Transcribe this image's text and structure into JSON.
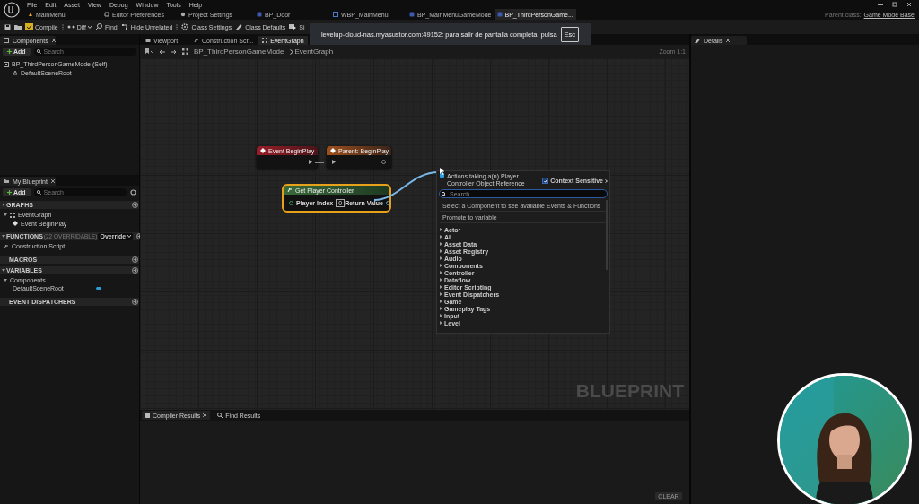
{
  "menu_bar": [
    "File",
    "Edit",
    "Asset",
    "View",
    "Debug",
    "Window",
    "Tools",
    "Help"
  ],
  "document_tabs": [
    {
      "label": "MainMenu",
      "selected": false
    },
    {
      "label": "Editor Preferences",
      "selected": false
    },
    {
      "label": "Project Settings",
      "selected": false
    },
    {
      "label": "BP_Door",
      "selected": false
    },
    {
      "label": "WBP_MainMenu",
      "selected": false
    },
    {
      "label": "BP_MainMenuGameMode",
      "selected": false
    },
    {
      "label": "BP_ThirdPersonGame...",
      "selected": true
    }
  ],
  "parent_class": {
    "label": "Parent class:",
    "value": "Game Mode Base"
  },
  "toolbar": [
    {
      "kind": "compile",
      "label": "Compile"
    },
    {
      "kind": "diff",
      "label": "Diff"
    },
    {
      "kind": "find",
      "label": "Find"
    },
    {
      "kind": "hide",
      "label": "Hide Unrelated"
    },
    {
      "kind": "settings",
      "label": "Class Settings"
    },
    {
      "kind": "defaults",
      "label": "Class Defaults"
    },
    {
      "kind": "simulate",
      "label": "Si"
    }
  ],
  "fullscreen_notice": {
    "text": "levelup-cloud-nas.myasustor.com:49152: para salir de pantalla completa, pulsa",
    "key": "Esc"
  },
  "components_panel": {
    "title": "Components",
    "add": "Add",
    "search_placeholder": "Search",
    "items": [
      {
        "label": "BP_ThirdPersonGameMode (Self)",
        "children": [
          {
            "label": "DefaultSceneRoot"
          }
        ]
      }
    ]
  },
  "my_blueprint": {
    "title": "My Blueprint",
    "add": "Add",
    "search_placeholder": "Search",
    "sections": [
      {
        "title": "GRAPHS",
        "items": [
          {
            "label": "EventGraph",
            "children": [
              {
                "label": "Event BeginPlay"
              }
            ]
          }
        ]
      },
      {
        "title": "FUNCTIONS",
        "note": "(22 OVERRIDABLE)",
        "button": "Override",
        "items": [
          {
            "label": "Construction Script"
          }
        ]
      },
      {
        "title": "MACROS"
      },
      {
        "title": "VARIABLES",
        "items": [
          {
            "label": "Components",
            "children": [
              {
                "label": "DefaultSceneRoot"
              }
            ]
          }
        ]
      },
      {
        "title": "EVENT DISPATCHERS"
      }
    ]
  },
  "editor_tabs": [
    {
      "label": "Viewport",
      "selected": false
    },
    {
      "label": "Construction Scr...",
      "selected": false
    },
    {
      "label": "EventGraph",
      "selected": true
    }
  ],
  "breadcrumb": [
    "BP_ThirdPersonGameMode",
    "EventGraph"
  ],
  "zoom_label": "Zoom 1:1",
  "nodes": [
    {
      "kind": "event",
      "title": "Event BeginPlay",
      "selected": false
    },
    {
      "kind": "parent",
      "title": "Parent: BeginPlay",
      "selected": false
    },
    {
      "kind": "function",
      "title": "Get Player Controller",
      "input": "Player Index",
      "input_value": "0",
      "output": "Return Value",
      "selected": true
    }
  ],
  "action_menu": {
    "title": "Actions taking a(n) Player Controller Object Reference",
    "context_sensitive": {
      "label": "Context Sensitive",
      "checked": true
    },
    "search_placeholder": "Search",
    "items": [
      "Select a Component to see available Events & Functions",
      "Promote to variable"
    ],
    "categories": [
      "Actor",
      "AI",
      "Asset Data",
      "Asset Registry",
      "Audio",
      "Components",
      "Controller",
      "Dataflow",
      "Editor Scripting",
      "Event Dispatchers",
      "Game",
      "Gameplay Tags",
      "Input",
      "Level"
    ]
  },
  "graph_label": "BLUEPRINT",
  "bottom_tabs": [
    {
      "label": "Compiler Results",
      "selected": true
    },
    {
      "label": "Find Results",
      "selected": false
    }
  ],
  "clear_button": "CLEAR",
  "details_panel": {
    "title": "Details"
  }
}
